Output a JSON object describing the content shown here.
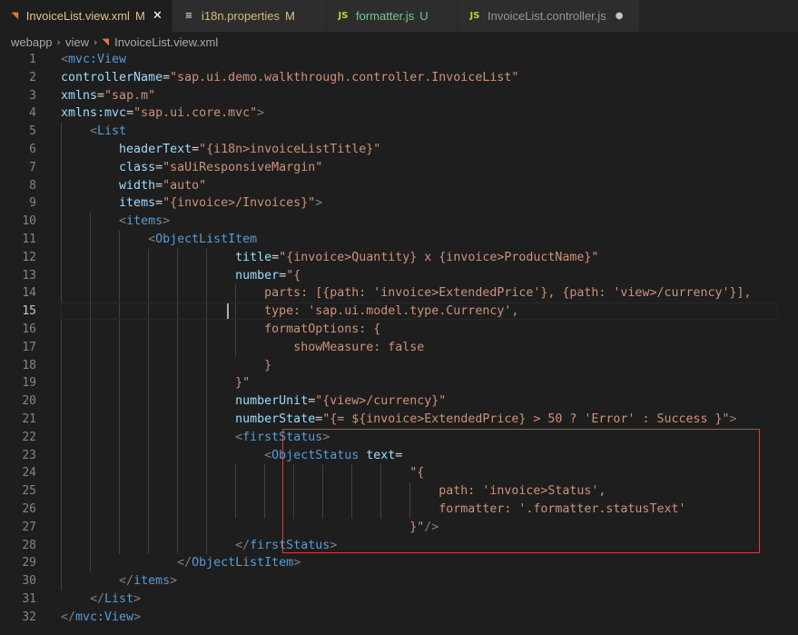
{
  "tabs": [
    {
      "label": "InvoiceList.view.xml",
      "icon": "rss-icon",
      "status": "M",
      "status_color": "#e2c08d",
      "active": true
    },
    {
      "label": "i18n.properties",
      "icon": "properties-icon",
      "status": "M",
      "status_color": "#e2c08d",
      "active": false
    },
    {
      "label": "formatter.js",
      "icon": "js-icon",
      "status": "U",
      "status_color": "#73c991",
      "label_color": "#73c991",
      "active": false
    },
    {
      "label": "InvoiceList.controller.js",
      "icon": "js-icon",
      "status": "",
      "active": false,
      "dirty": true
    }
  ],
  "tab_icon_text": {
    "js": "JS",
    "props": "≡",
    "rss": "◥"
  },
  "tab_close": "✕",
  "tab_dot": "●",
  "breadcrumb": [
    "webapp",
    "view",
    "InvoiceList.view.xml"
  ],
  "breadcrumb_sep": "›",
  "editor": {
    "current_line": 15,
    "lines": [
      {
        "n": 1,
        "t": [
          [
            "t-br",
            "<"
          ],
          [
            "t-tag",
            "mvc:View"
          ]
        ]
      },
      {
        "n": 2,
        "t": [
          [
            "t-attr",
            "controllerName"
          ],
          [
            "t-eq",
            "="
          ],
          [
            "t-str",
            "\"sap.ui.demo.walkthrough.controller.InvoiceList\""
          ]
        ]
      },
      {
        "n": 3,
        "t": [
          [
            "t-attr",
            "xmlns"
          ],
          [
            "t-eq",
            "="
          ],
          [
            "t-str",
            "\"sap.m\""
          ]
        ]
      },
      {
        "n": 4,
        "t": [
          [
            "t-attr",
            "xmlns:mvc"
          ],
          [
            "t-eq",
            "="
          ],
          [
            "t-str",
            "\"sap.ui.core.mvc\""
          ],
          [
            "t-br",
            ">"
          ]
        ]
      },
      {
        "n": 5,
        "t": [
          [
            "",
            "    "
          ],
          [
            "t-br",
            "<"
          ],
          [
            "t-tag",
            "List"
          ]
        ]
      },
      {
        "n": 6,
        "t": [
          [
            "",
            "        "
          ],
          [
            "t-attr",
            "headerText"
          ],
          [
            "t-eq",
            "="
          ],
          [
            "t-str",
            "\"{i18n>invoiceListTitle}\""
          ]
        ]
      },
      {
        "n": 7,
        "t": [
          [
            "",
            "        "
          ],
          [
            "t-attr",
            "class"
          ],
          [
            "t-eq",
            "="
          ],
          [
            "t-str",
            "\"saUiResponsiveMargin\""
          ]
        ]
      },
      {
        "n": 8,
        "t": [
          [
            "",
            "        "
          ],
          [
            "t-attr",
            "width"
          ],
          [
            "t-eq",
            "="
          ],
          [
            "t-str",
            "\"auto\""
          ]
        ]
      },
      {
        "n": 9,
        "t": [
          [
            "",
            "        "
          ],
          [
            "t-attr",
            "items"
          ],
          [
            "t-eq",
            "="
          ],
          [
            "t-str",
            "\"{invoice>/Invoices}\""
          ],
          [
            "t-br",
            ">"
          ]
        ]
      },
      {
        "n": 10,
        "t": [
          [
            "",
            "        "
          ],
          [
            "t-br",
            "<"
          ],
          [
            "t-tag",
            "items"
          ],
          [
            "t-br",
            ">"
          ]
        ]
      },
      {
        "n": 11,
        "t": [
          [
            "",
            "            "
          ],
          [
            "t-br",
            "<"
          ],
          [
            "t-tag",
            "ObjectListItem"
          ]
        ]
      },
      {
        "n": 12,
        "t": [
          [
            "",
            "                        "
          ],
          [
            "t-attr",
            "title"
          ],
          [
            "t-eq",
            "="
          ],
          [
            "t-str",
            "\"{invoice>Quantity} x {invoice>ProductName}\""
          ]
        ]
      },
      {
        "n": 13,
        "t": [
          [
            "",
            "                        "
          ],
          [
            "t-attr",
            "number"
          ],
          [
            "t-eq",
            "="
          ],
          [
            "t-str",
            "\"{"
          ]
        ]
      },
      {
        "n": 14,
        "t": [
          [
            "",
            "                            "
          ],
          [
            "t-str",
            "parts: [{path: 'invoice>ExtendedPrice'}, {path: 'view>/currency'}],"
          ]
        ]
      },
      {
        "n": 15,
        "t": [
          [
            "",
            "                            "
          ],
          [
            "t-str",
            "type: 'sap.ui.model.type.Currency',"
          ]
        ]
      },
      {
        "n": 16,
        "t": [
          [
            "",
            "                            "
          ],
          [
            "t-str",
            "formatOptions: {"
          ]
        ]
      },
      {
        "n": 17,
        "t": [
          [
            "",
            "                                "
          ],
          [
            "t-str",
            "showMeasure: false"
          ]
        ]
      },
      {
        "n": 18,
        "t": [
          [
            "",
            "                            "
          ],
          [
            "t-str",
            "}"
          ]
        ]
      },
      {
        "n": 19,
        "t": [
          [
            "",
            "                        "
          ],
          [
            "t-str",
            "}\""
          ]
        ]
      },
      {
        "n": 20,
        "t": [
          [
            "",
            "                        "
          ],
          [
            "t-attr",
            "numberUnit"
          ],
          [
            "t-eq",
            "="
          ],
          [
            "t-str",
            "\"{view>/currency}\""
          ]
        ]
      },
      {
        "n": 21,
        "t": [
          [
            "",
            "                        "
          ],
          [
            "t-attr",
            "numberState"
          ],
          [
            "t-eq",
            "="
          ],
          [
            "t-str",
            "\"{= ${invoice>ExtendedPrice} > 50 ? 'Error' : Success }\""
          ],
          [
            "t-br",
            ">"
          ]
        ]
      },
      {
        "n": 22,
        "t": [
          [
            "",
            "                        "
          ],
          [
            "t-br",
            "<"
          ],
          [
            "t-tag",
            "firstStatus"
          ],
          [
            "t-br",
            ">"
          ]
        ]
      },
      {
        "n": 23,
        "t": [
          [
            "",
            "                            "
          ],
          [
            "t-br",
            "<"
          ],
          [
            "t-tag",
            "ObjectStatus"
          ],
          [
            "",
            " "
          ],
          [
            "t-attr",
            "text"
          ],
          [
            "t-eq",
            "="
          ]
        ]
      },
      {
        "n": 24,
        "t": [
          [
            "",
            "                                                "
          ],
          [
            "t-str",
            "\"{"
          ]
        ]
      },
      {
        "n": 25,
        "t": [
          [
            "",
            "                                                    "
          ],
          [
            "t-str",
            "path: 'invoice>Status',"
          ]
        ]
      },
      {
        "n": 26,
        "t": [
          [
            "",
            "                                                    "
          ],
          [
            "t-str",
            "formatter: '.formatter.statusText'"
          ]
        ]
      },
      {
        "n": 27,
        "t": [
          [
            "",
            "                                                "
          ],
          [
            "t-str",
            "}\""
          ],
          [
            "t-br",
            "/>"
          ]
        ]
      },
      {
        "n": 28,
        "t": [
          [
            "",
            "                        "
          ],
          [
            "t-br",
            "</"
          ],
          [
            "t-tag",
            "firstStatus"
          ],
          [
            "t-br",
            ">"
          ]
        ]
      },
      {
        "n": 29,
        "t": [
          [
            "",
            "                "
          ],
          [
            "t-br",
            "</"
          ],
          [
            "t-tag",
            "ObjectListItem"
          ],
          [
            "t-br",
            ">"
          ]
        ]
      },
      {
        "n": 30,
        "t": [
          [
            "",
            "        "
          ],
          [
            "t-br",
            "</"
          ],
          [
            "t-tag",
            "items"
          ],
          [
            "t-br",
            ">"
          ]
        ]
      },
      {
        "n": 31,
        "t": [
          [
            "",
            "    "
          ],
          [
            "t-br",
            "</"
          ],
          [
            "t-tag",
            "List"
          ],
          [
            "t-br",
            ">"
          ]
        ]
      },
      {
        "n": 32,
        "t": [
          [
            "t-br",
            "</"
          ],
          [
            "t-tag",
            "mvc:View"
          ],
          [
            "t-br",
            ">"
          ]
        ]
      }
    ]
  },
  "colors": {
    "tag": "#569cd6",
    "attr": "#9cdcfe",
    "string": "#ce9178",
    "highlight_box": "#e0393f"
  }
}
